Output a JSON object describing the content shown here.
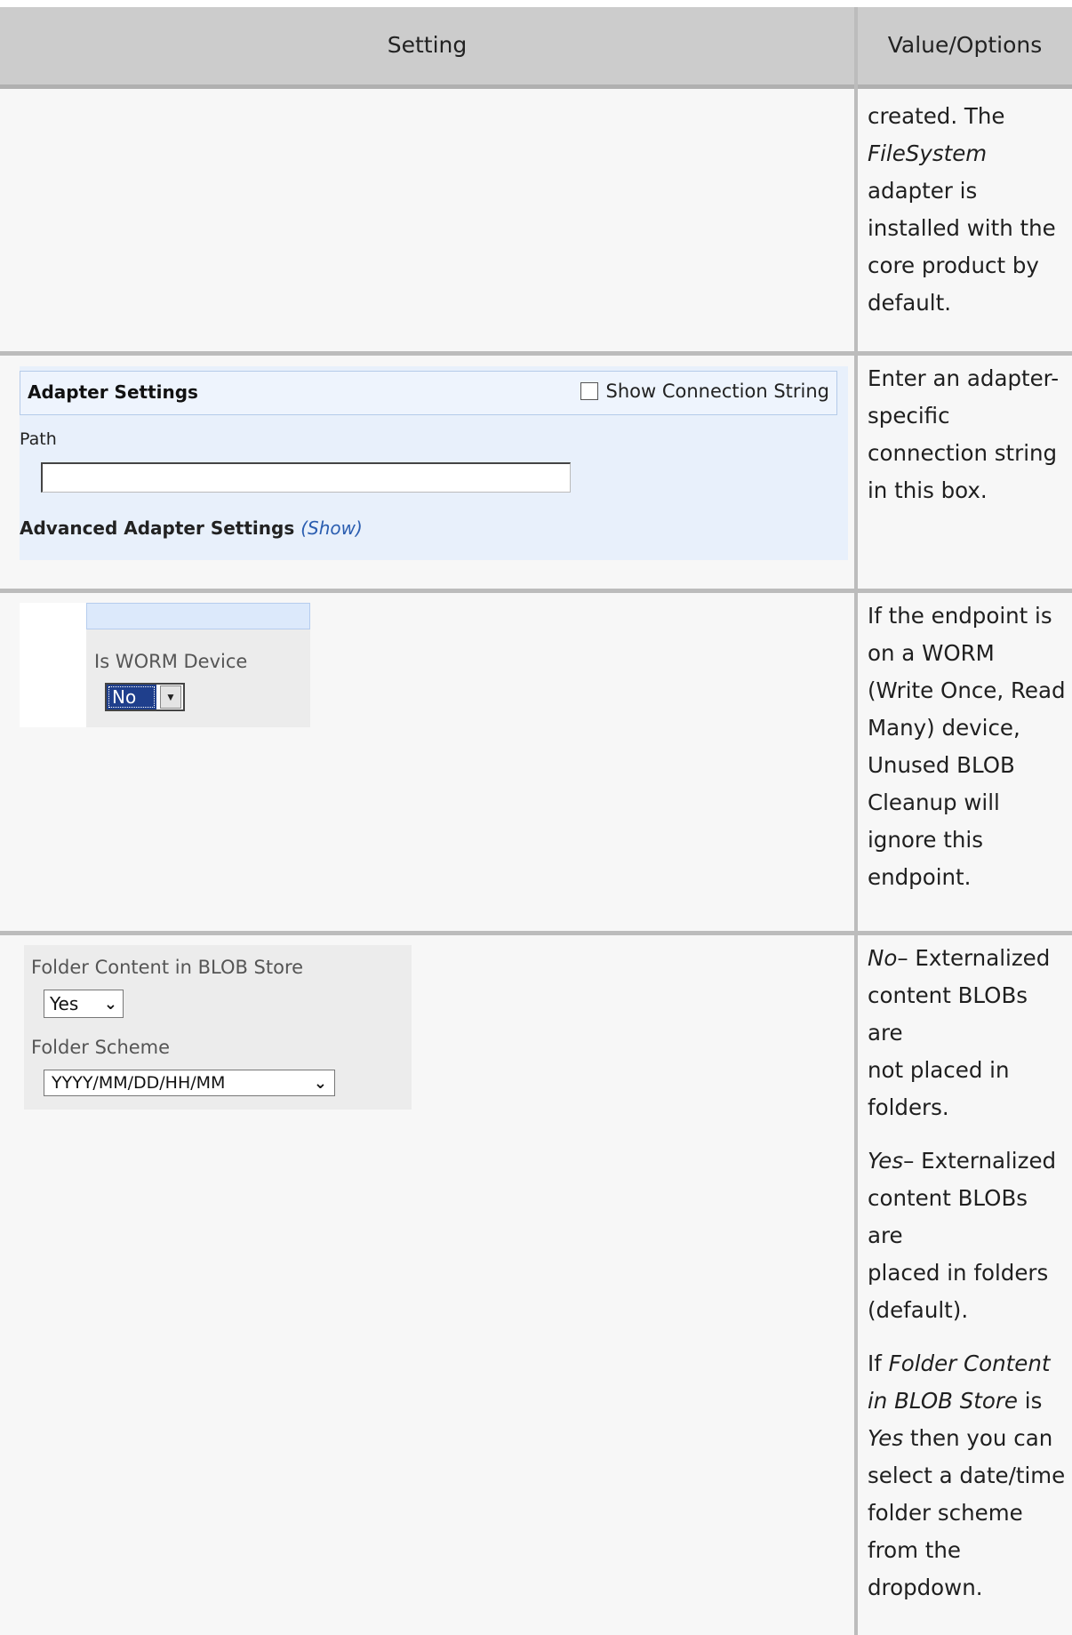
{
  "header": {
    "setting": "Setting",
    "value": "Value/Options"
  },
  "row1": {
    "value_lines": [
      "created. The",
      "FileSystem",
      "adapter is",
      "installed with the",
      "core product by",
      "default."
    ]
  },
  "row2": {
    "panel_title": "Adapter Settings",
    "show_connection_label": "Show Connection String",
    "path_label": "Path",
    "path_value": "",
    "advanced_label": "Advanced Adapter Settings",
    "advanced_show": "(Show)",
    "value_lines": [
      "Enter an adapter-",
      "specific",
      "connection string",
      "in this box."
    ]
  },
  "row3": {
    "worm_label": "Is WORM Device",
    "worm_value": "No",
    "value_lines": [
      "If the endpoint is",
      "on a WORM",
      "(Write Once, Read",
      "Many) device,",
      "Unused BLOB",
      "Cleanup will",
      "ignore this",
      "endpoint."
    ]
  },
  "row4": {
    "folder_content_label": "Folder Content in BLOB Store",
    "folder_content_value": "Yes",
    "folder_scheme_label": "Folder Scheme",
    "folder_scheme_value": "YYYY/MM/DD/HH/MM",
    "p1_em": "No",
    "p1_lines": [
      "– Externalized",
      "content BLOBs are",
      "not placed in",
      "folders."
    ],
    "p2_em": "Yes",
    "p2_lines": [
      "– Externalized",
      "content BLOBs are",
      "placed in folders",
      "(default)."
    ],
    "p3": {
      "a": "If ",
      "em1": "Folder Content",
      "em2": "in BLOB Store",
      "b": " is",
      "em3": "Yes",
      "c": " then you can",
      "lines": [
        "select a date/time",
        "folder scheme",
        "from the",
        "dropdown."
      ]
    }
  }
}
